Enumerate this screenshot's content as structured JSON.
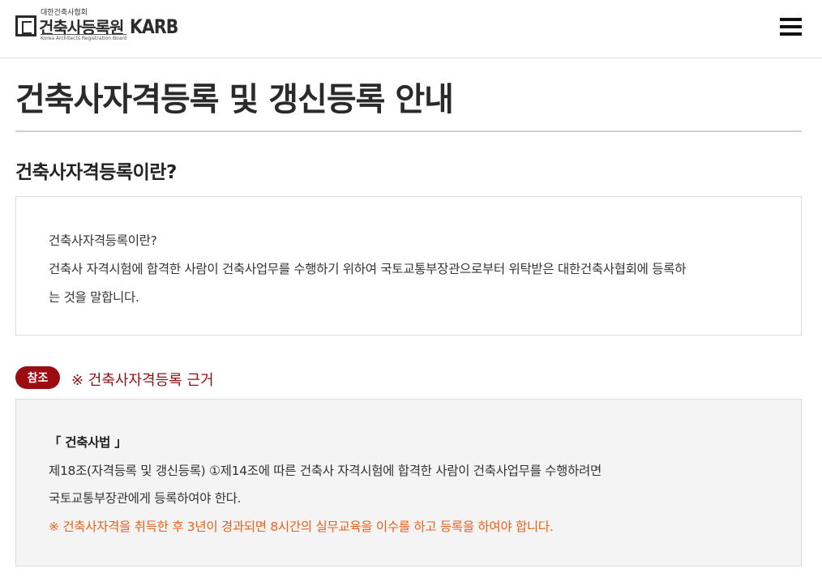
{
  "header": {
    "logo": {
      "sub": "대한건축사협회",
      "main": "건축사등록원",
      "english": "Korea Architects Registration Board",
      "abbr": "KARB"
    },
    "menu_icon": "hamburger-menu-icon"
  },
  "page": {
    "title": "건축사자격등록 및 갱신등록 안내"
  },
  "section": {
    "heading": "건축사자격등록이란?",
    "box_lines": [
      "건축사자격등록이란?",
      "건축사 자격시험에 합격한 사람이 건축사업무를 수행하기 위하여 국토교통부장관으로부터 위탁받은 대한건축사협회에 등록하",
      "는 것을 말합니다."
    ]
  },
  "reference": {
    "badge": "참조",
    "title": "※ 건축사자격등록 근거",
    "law": "「 건축사법 」",
    "lines": [
      "제18조(자격등록 및 갱신등록) ①제14조에 따른 건축사 자격시험에 합격한 사람이 건축사업무를 수행하려면",
      "국토교통부장관에게 등록하여야 한다."
    ],
    "note": "※ 건축사자격을 취득한 후 3년이 경과되면 8시간의 실무교육을 이수를 하고 등록을 하여야 합니다."
  },
  "colors": {
    "badge": "#9c0d12",
    "ref_title": "#8e1014",
    "note": "#e8611c",
    "ref_box_bg": "#f4f4f4"
  }
}
